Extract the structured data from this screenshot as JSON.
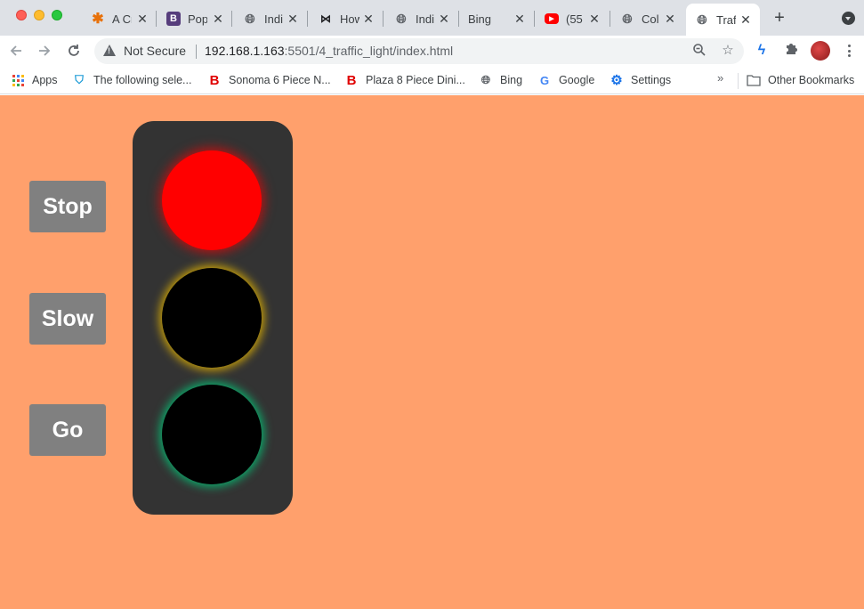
{
  "tabs": [
    {
      "label": "A Cr",
      "icon": "asterisk-icon",
      "active": false
    },
    {
      "label": "Pop",
      "icon": "bootstrap-icon",
      "active": false
    },
    {
      "label": "Indi",
      "icon": "globe-icon",
      "active": false
    },
    {
      "label": "How",
      "icon": "bowtie-icon",
      "active": false
    },
    {
      "label": "Indi",
      "icon": "globe-icon",
      "active": false
    },
    {
      "label": "Bing",
      "icon": "",
      "active": false
    },
    {
      "label": "(55",
      "icon": "youtube-icon",
      "active": false
    },
    {
      "label": "Col",
      "icon": "globe-icon",
      "active": false
    },
    {
      "label": "Traf",
      "icon": "globe-icon",
      "active": true
    }
  ],
  "toolbar": {
    "security_label": "Not Secure",
    "url_host": "192.168.1.163",
    "url_rest": ":5501/4_traffic_light/index.html"
  },
  "bookmarks": [
    {
      "label": "Apps",
      "icon": "apps-grid-icon"
    },
    {
      "label": "The following sele...",
      "icon": "shield-icon"
    },
    {
      "label": "Sonoma 6 Piece N...",
      "icon": "b-logo-icon"
    },
    {
      "label": "Plaza 8 Piece Dini...",
      "icon": "b-logo-icon"
    },
    {
      "label": "Bing",
      "icon": "globe-icon"
    },
    {
      "label": "Google",
      "icon": "google-icon"
    },
    {
      "label": "Settings",
      "icon": "gear-icon"
    },
    {
      "label": "Other Bookmarks",
      "icon": "folder-icon"
    }
  ],
  "page": {
    "background": "#ffa06c",
    "buttons": {
      "stop": "Stop",
      "slow": "Slow",
      "go": "Go"
    },
    "light_state": {
      "red": "on",
      "yellow": "off",
      "green": "off"
    },
    "colors": {
      "red": "#ff0000",
      "off": "#000000",
      "housing": "#333333",
      "button": "#808080"
    }
  }
}
